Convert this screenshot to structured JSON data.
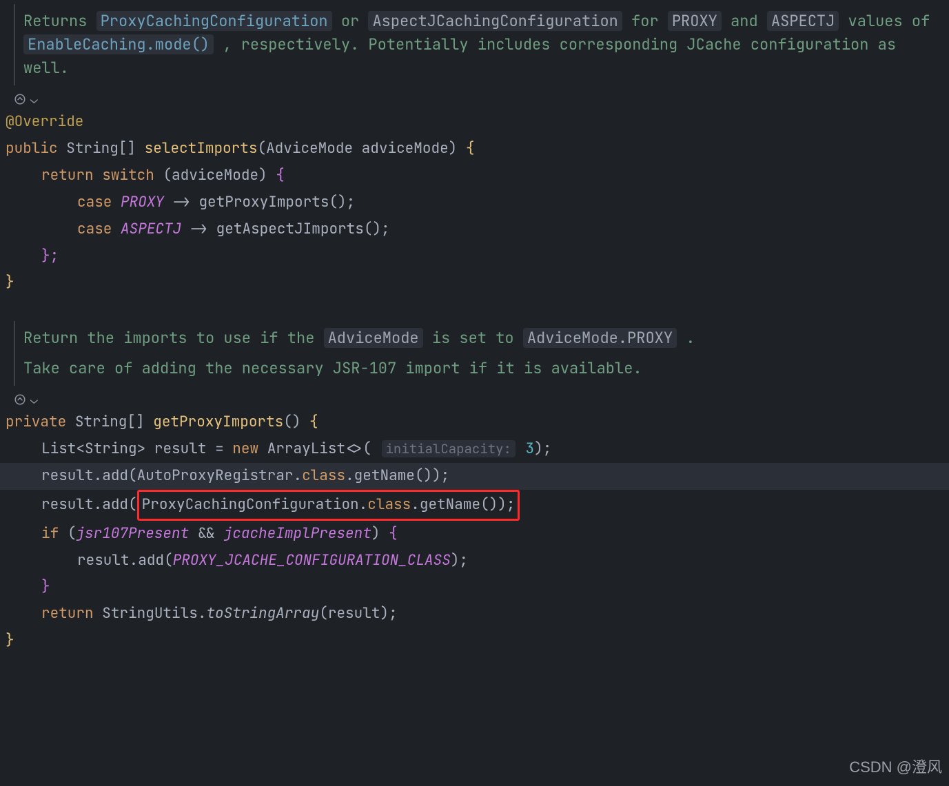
{
  "doc1": {
    "t1": "Returns ",
    "link1": "ProxyCachingConfiguration",
    "t2": " or ",
    "code1": "AspectJCachingConfiguration",
    "t3": " for ",
    "code2": "PROXY",
    "t4": " and ",
    "code3": "ASPECTJ",
    "t5": " values of ",
    "link2": "EnableCaching.mode()",
    "t6": ", respectively. Potentially includes corresponding JCache configuration as well."
  },
  "method1": {
    "annotation": "@Override",
    "kw_public": "public",
    "ret_type": "String",
    "brackets": "[]",
    "name": "selectImports",
    "param_type": "AdviceMode",
    "param_name": "adviceMode",
    "kw_return": "return",
    "kw_switch": "switch",
    "switch_expr": "adviceMode",
    "case1_kw": "case",
    "case1_val": "PROXY",
    "case1_call": "getProxyImports",
    "case2_kw": "case",
    "case2_val": "ASPECTJ",
    "case2_call": "getAspectJImports",
    "arrow": "->"
  },
  "doc2": {
    "t1": "Return the imports to use if the ",
    "code1": "AdviceMode",
    "t2": " is set to ",
    "code2": "AdviceMode.PROXY",
    "t3": ".",
    "p2": "Take care of adding the necessary JSR-107 import if it is available."
  },
  "method2": {
    "kw_private": "private",
    "ret_type": "String",
    "brackets": "[]",
    "name": "getProxyImports",
    "l1_type_list": "List",
    "l1_type_param": "String",
    "l1_var": "result",
    "l1_new": "new",
    "l1_class": "ArrayList",
    "l1_hint": "initialCapacity:",
    "l1_cap": "3",
    "add": "add",
    "arg1": "AutoProxyRegistrar",
    "class_kw": "class",
    "getName": "getName",
    "arg2": "ProxyCachingConfiguration",
    "kw_if": "if",
    "cond_a": "jsr107Present",
    "amp": "&&",
    "cond_b": "jcacheImplPresent",
    "const1": "PROXY_JCACHE_CONFIGURATION_CLASS",
    "kw_return": "return",
    "util": "StringUtils",
    "toStrArr": "toStringArray",
    "resArg": "result"
  },
  "watermark": "CSDN @澄风"
}
